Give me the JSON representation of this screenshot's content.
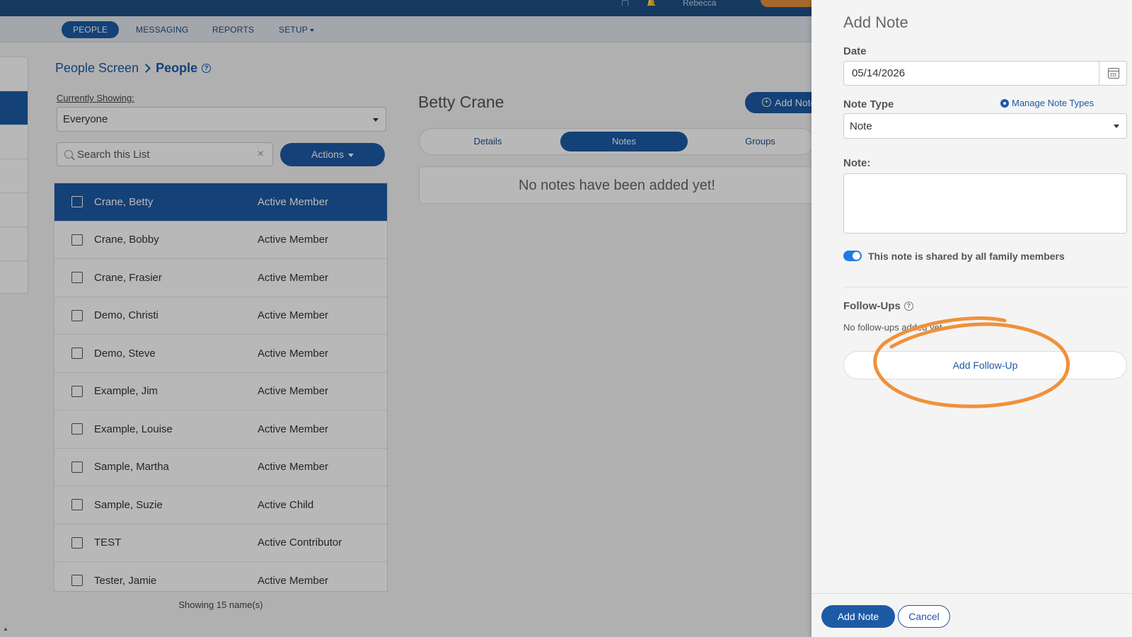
{
  "topbar": {
    "user": "Rebecca",
    "help": "Help"
  },
  "nav": {
    "items": [
      {
        "label": "PEOPLE"
      },
      {
        "label": "MESSAGING"
      },
      {
        "label": "REPORTS"
      },
      {
        "label": "SETUP"
      }
    ]
  },
  "breadcrumb": {
    "parent": "People Screen",
    "current": "People"
  },
  "filter": {
    "label": "Currently Showing:",
    "value": "Everyone"
  },
  "search": {
    "placeholder": "Search this List",
    "clear": "×"
  },
  "actions": {
    "label": "Actions"
  },
  "people": [
    {
      "name": "Crane, Betty",
      "status": "Active Member"
    },
    {
      "name": "Crane, Bobby",
      "status": "Active Member"
    },
    {
      "name": "Crane, Frasier",
      "status": "Active Member"
    },
    {
      "name": "Demo, Christi",
      "status": "Active Member"
    },
    {
      "name": "Demo, Steve",
      "status": "Active Member"
    },
    {
      "name": "Example, Jim",
      "status": "Active Member"
    },
    {
      "name": "Example, Louise",
      "status": "Active Member"
    },
    {
      "name": "Sample, Martha",
      "status": "Active Member"
    },
    {
      "name": "Sample, Suzie",
      "status": "Active Child"
    },
    {
      "name": "TEST",
      "status": "Active Contributor"
    },
    {
      "name": "Tester, Jamie",
      "status": "Active Member"
    }
  ],
  "list_footer": "Showing 15 name(s)",
  "detail": {
    "name": "Betty Crane",
    "add_note": "Add Note",
    "tabs": [
      {
        "label": "Details"
      },
      {
        "label": "Notes"
      },
      {
        "label": "Groups"
      }
    ],
    "empty_notes": "No notes have been added yet!"
  },
  "panel": {
    "title": "Add Note",
    "date_label": "Date",
    "date_value": "05/14/2026",
    "note_type_label": "Note Type",
    "manage_link": "Manage Note Types",
    "note_type_value": "Note",
    "note_label": "Note:",
    "note_value": "",
    "shared_label": "This note is shared by all family members",
    "followups_label": "Follow-Ups",
    "no_followups": "No follow-ups added yet",
    "add_followup": "Add Follow-Up",
    "add_button": "Add Note",
    "cancel_button": "Cancel"
  },
  "colors": {
    "primary": "#1d5aa5",
    "annotation": "#f0913a"
  }
}
